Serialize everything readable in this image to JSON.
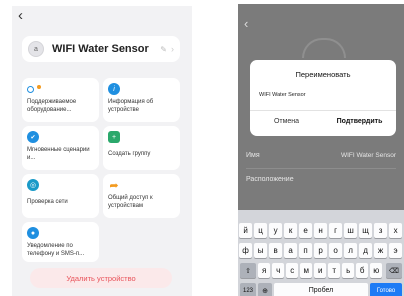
{
  "left": {
    "back": "‹",
    "avatar": "a",
    "device_name": "WIFI Water Sensor",
    "edit_icon": "pencil-icon",
    "chevron": "›",
    "cards": [
      {
        "icon": "supported-hardware-icon",
        "label": "Поддерживаемое оборудование..."
      },
      {
        "icon": "info-icon",
        "label": "Информация об устройстве"
      },
      {
        "icon": "scenario-icon",
        "label": "Мгновенные сценарии и..."
      },
      {
        "icon": "create-group-icon",
        "label": "Создать группу"
      },
      {
        "icon": "network-check-icon",
        "label": "Проверка сети"
      },
      {
        "icon": "share-icon",
        "label": "Общий доступ к устройствам"
      },
      {
        "icon": "notification-icon",
        "label": "Уведомление по телефону и SMS-п..."
      }
    ],
    "delete_label": "Удалить устройство"
  },
  "right": {
    "back": "‹",
    "dialog": {
      "title": "Переименовать",
      "value": "WIFI Water Sensor",
      "cancel": "Отмена",
      "confirm": "Подтвердить"
    },
    "rows": [
      {
        "key": "Имя",
        "value": "WIFI Water Sensor"
      },
      {
        "key": "Расположение",
        "value": ""
      }
    ],
    "keyboard": {
      "row1": [
        "й",
        "ц",
        "у",
        "к",
        "е",
        "н",
        "г",
        "ш",
        "щ",
        "з",
        "х"
      ],
      "row2": [
        "ф",
        "ы",
        "в",
        "а",
        "п",
        "р",
        "о",
        "л",
        "д",
        "ж",
        "э"
      ],
      "row3": [
        "я",
        "ч",
        "с",
        "м",
        "и",
        "т",
        "ь",
        "б",
        "ю"
      ],
      "shift": "⇧",
      "backspace": "⌫",
      "numbers": "123",
      "globe": "🌐",
      "space": "Пробел",
      "done": "Готово"
    }
  },
  "colors": {
    "accent_blue": "#1f8fe0",
    "delete_red": "#e9535a",
    "overlay": "#7b7b7b"
  }
}
